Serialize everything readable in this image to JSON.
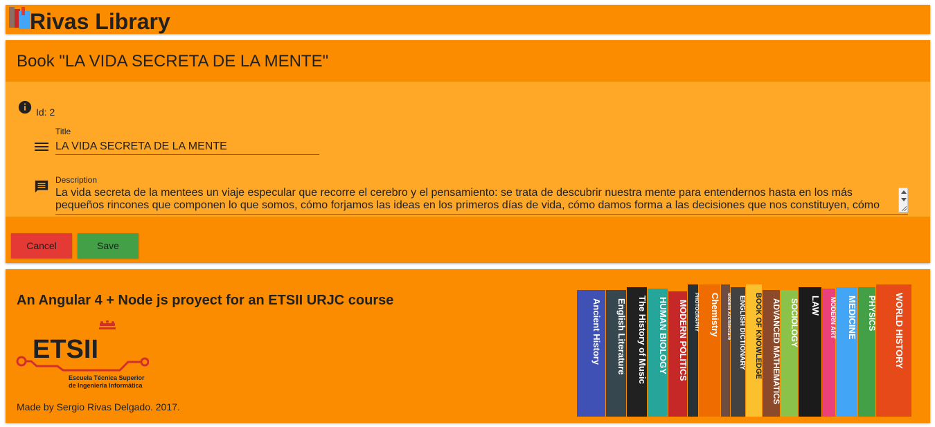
{
  "app": {
    "title": "Rivas Library"
  },
  "book_card": {
    "header": "Book \"LA VIDA SECRETA DE LA MENTE\"",
    "id_text": "Id: 2",
    "title_label": "Title",
    "title_value": "LA VIDA SECRETA DE LA MENTE",
    "description_label": "Description",
    "description_value": "La vida secreta de la mentees un viaje especular que recorre el cerebro y el pensamiento: se trata de descubrir nuestra mente para entendernos hasta en los más pequeños rincones que componen lo que somos, cómo forjamos las ideas en los primeros días de vida, cómo damos forma a las decisiones que nos constituyen, cómo",
    "cancel_label": "Cancel",
    "save_label": "Save"
  },
  "footer": {
    "heading": "An Angular 4 + Node js proyect for an ETSII URJC course",
    "logo_text": "ETSII",
    "logo_subtitle_1": "Escuela Técnica Superior",
    "logo_subtitle_2": "de Ingeniería Informática",
    "made_by": "Made by Sergio Rivas Delgado. 2017.",
    "book_spines": [
      "Ancient History",
      "English Literature",
      "The History of Music",
      "HUMAN BIOLOGY",
      "MODERN POLITICS",
      "PHOTOGRAPHY",
      "Chemistry",
      "Modern Architecture",
      "ENGLISH DICTIONARY",
      "BOOK OF KNOWLEDGE",
      "ADVANCED MATHEMATICS",
      "SOCIOLOGY",
      "LAW",
      "MODERN ART",
      "MEDICINE",
      "PHYSICS",
      "WORLD HISTORY"
    ]
  },
  "colors": {
    "primary": "#fb8c00",
    "body": "#ffa726",
    "cancel": "#e53935",
    "save": "#43a047"
  },
  "icons": [
    "books-icon",
    "info-icon",
    "menu-icon",
    "comment-icon"
  ]
}
